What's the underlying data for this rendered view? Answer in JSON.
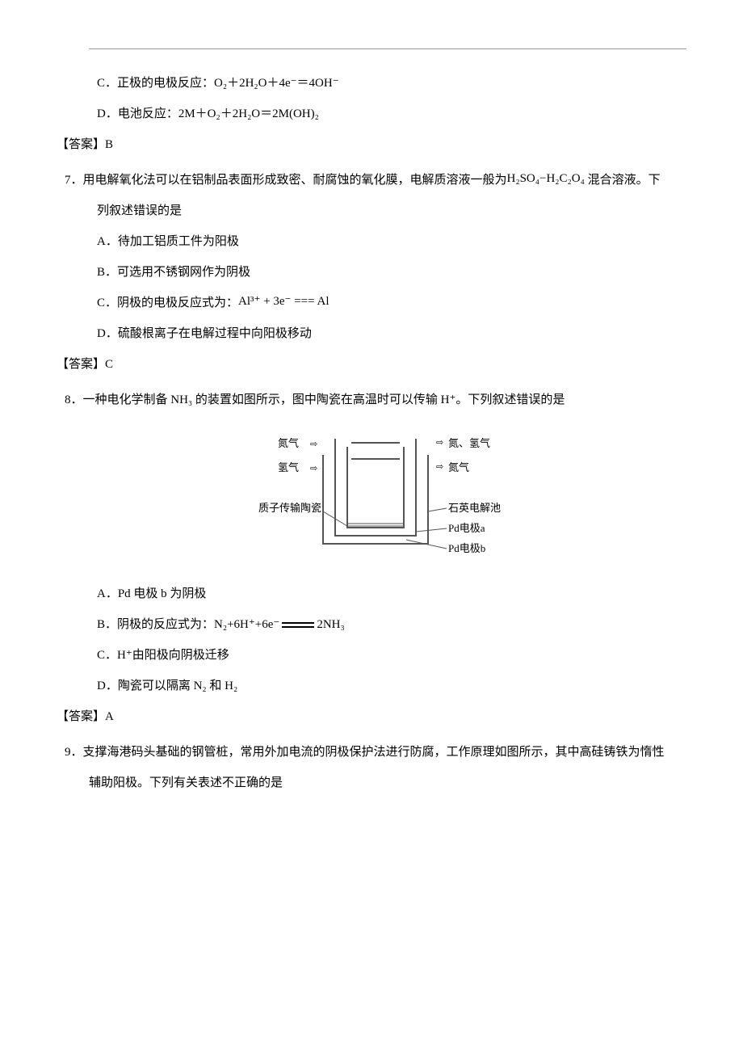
{
  "q6": {
    "optC_prefix": "C．正极的电极反应：",
    "optC_formula": "O₂＋2H₂O＋4e⁻＝4OH⁻",
    "optD_prefix": "D．电池反应：",
    "optD_formula": "2M＋O₂＋2H₂O＝2M(OH)₂",
    "answer": "【答案】B"
  },
  "q7": {
    "stem1": "7．用电解氧化法可以在铝制品表面形成致密、耐腐蚀的氧化膜，电解质溶液一般为",
    "stem_formula": "H₂SO₄−H₂C₂O₄",
    "stem2": "混合溶液。下",
    "stem3": "列叙述错误的是",
    "optA": "A．待加工铝质工件为阳极",
    "optB": "B．可选用不锈钢网作为阴极",
    "optC_prefix": "C．阴极的电极反应式为：",
    "optC_formula": "Al³⁺ + 3e⁻ === Al",
    "optD": "D．硫酸根离子在电解过程中向阳极移动",
    "answer": "【答案】C"
  },
  "q8": {
    "stem1": "8．一种电化学制备 NH₃ 的装置如图所示，图中陶瓷在高温时可以传输 H⁺。下列叙述错误的是",
    "diagram": {
      "left_top": "氮气",
      "left_bot": "氢气",
      "right_top": "氮、氢气",
      "right_bot": "氮气",
      "label_left": "质子传输陶瓷",
      "label_r1": "石英电解池",
      "label_r2": "Pd电极a",
      "label_r3": "Pd电极b"
    },
    "optA": "A．Pd 电极 b 为阴极",
    "optB_prefix": "B．阴极的反应式为：",
    "optB_formula1": "N₂+6H⁺+6e⁻",
    "optB_formula2": "2NH₃",
    "optC": "C．H⁺由阳极向阴极迁移",
    "optD": "D．陶瓷可以隔离 N₂ 和 H₂",
    "answer": "【答案】A"
  },
  "q9": {
    "stem1": "9．支撑海港码头基础的钢管桩，常用外加电流的阴极保护法进行防腐，工作原理如图所示，其中高硅铸铁为惰性",
    "stem2": "辅助阳极。下列有关表述不正确的是"
  }
}
